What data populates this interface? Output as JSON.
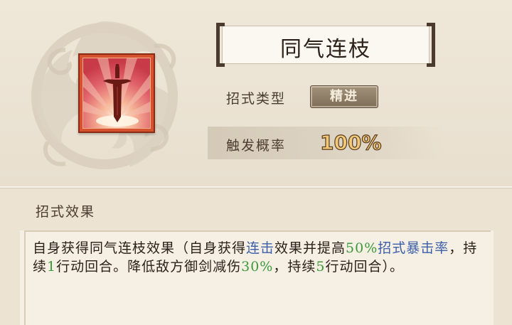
{
  "skill": {
    "name": "同气连枝",
    "type_label": "招式类型",
    "type_value": "精进",
    "prob_label": "触发概率",
    "prob_value": "100%",
    "icon": "sword-icon"
  },
  "effect": {
    "heading": "招式效果",
    "segments": [
      {
        "text": "自身获得同气连枝效果（自身获得",
        "style": "normal"
      },
      {
        "text": "连击",
        "style": "keyword"
      },
      {
        "text": "效果并提高",
        "style": "normal"
      },
      {
        "text": "50%",
        "style": "number"
      },
      {
        "text": "招式暴击率",
        "style": "keyword"
      },
      {
        "text": "，持续",
        "style": "normal"
      },
      {
        "text": "1",
        "style": "number"
      },
      {
        "text": "行动回合。降低敌方御剑减伤",
        "style": "normal"
      },
      {
        "text": "30%",
        "style": "number"
      },
      {
        "text": "，持续",
        "style": "normal"
      },
      {
        "text": "5",
        "style": "number"
      },
      {
        "text": "行动回合）。",
        "style": "normal"
      }
    ]
  },
  "colors": {
    "keyword": "#3b5fa8",
    "number": "#3c9a3a",
    "icon_frame": "#d6522f"
  }
}
